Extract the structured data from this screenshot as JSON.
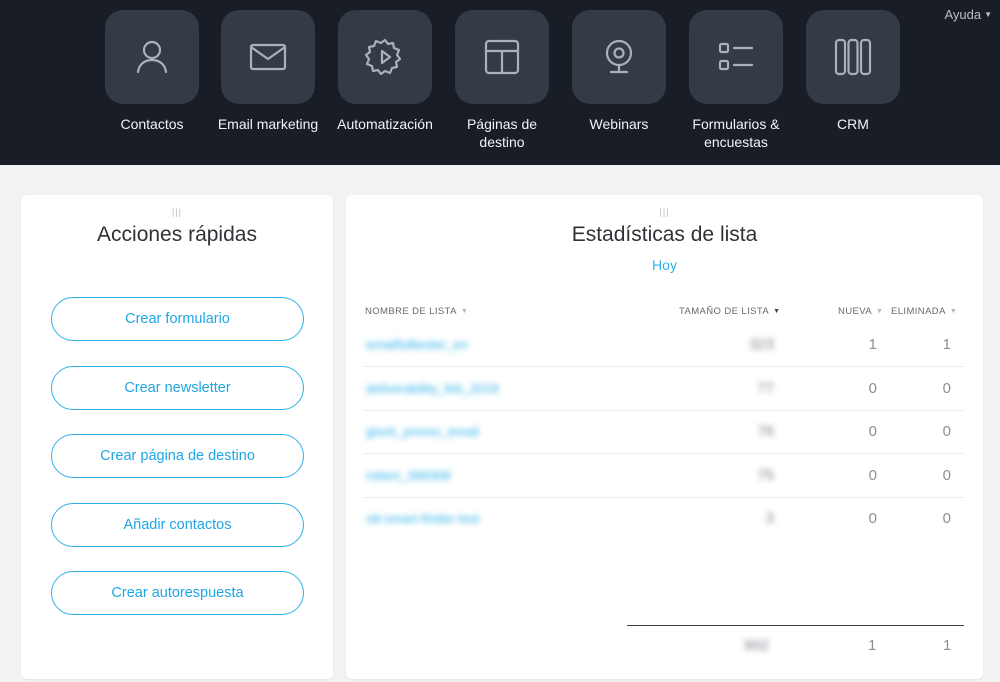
{
  "header": {
    "help_label": "Ayuda",
    "nav": [
      {
        "label": "Contactos",
        "icon": "user-icon"
      },
      {
        "label": "Email marketing",
        "icon": "envelope-icon"
      },
      {
        "label": "Automatización",
        "icon": "gear-play-icon"
      },
      {
        "label": "Páginas de\ndestino",
        "icon": "layout-icon"
      },
      {
        "label": "Webinars",
        "icon": "webcam-icon"
      },
      {
        "label": "Formularios &\nencuestas",
        "icon": "form-list-icon"
      },
      {
        "label": "CRM",
        "icon": "columns-icon"
      }
    ]
  },
  "quick_actions": {
    "title": "Acciones rápidas",
    "buttons": [
      "Crear formulario",
      "Crear newsletter",
      "Crear página de destino",
      "Añadir contactos",
      "Crear autorespuesta"
    ]
  },
  "list_stats": {
    "title": "Estadísticas de lista",
    "period": "Hoy",
    "columns": {
      "name": "NOMBRE DE LISTA",
      "size": "TAMAÑO DE LISTA",
      "new": "NUEVA",
      "deleted": "ELIMINADA"
    },
    "rows": [
      {
        "name": "emailfulltester_en",
        "size": "323",
        "new": "1",
        "deleted": "1"
      },
      {
        "name": "deliverability_feb_2018",
        "size": "77",
        "new": "0",
        "deleted": "0"
      },
      {
        "name": "glock_promo_email",
        "size": "76",
        "new": "0",
        "deleted": "0"
      },
      {
        "name": "robert_398308",
        "size": "75",
        "new": "0",
        "deleted": "0"
      },
      {
        "name": "ott-smart-finder-test",
        "size": "3",
        "new": "0",
        "deleted": "0"
      }
    ],
    "totals": {
      "size": "902",
      "new": "1",
      "deleted": "1"
    }
  },
  "colors": {
    "topbar": "#181d26",
    "tile": "#333b47",
    "accent": "#2fb1e8"
  }
}
